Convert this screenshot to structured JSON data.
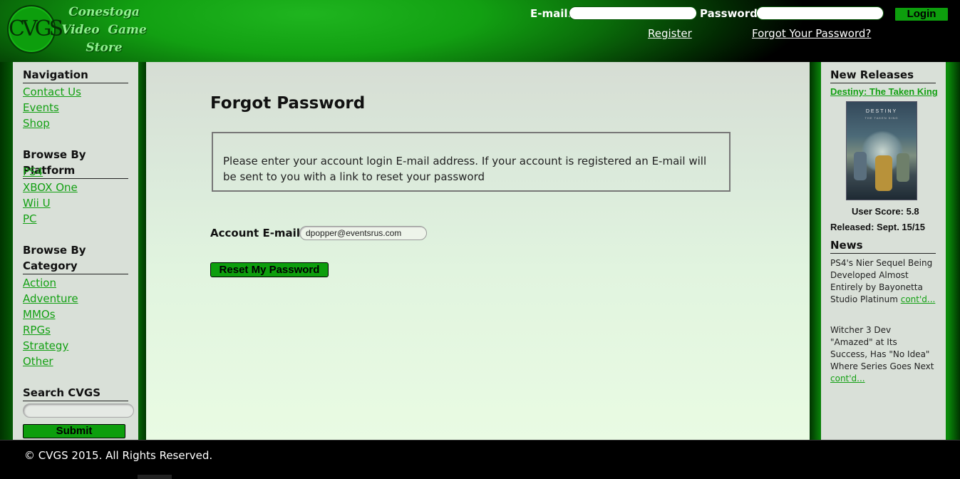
{
  "header": {
    "logo_mark": "CVGS",
    "logo_lines": [
      "Conestoga",
      "Video  Game",
      "Store"
    ],
    "email_label": "E-mail:",
    "password_label": "Password:",
    "login_label": "Login",
    "register_label": "Register",
    "forgot_label": "Forgot Your Password?"
  },
  "left": {
    "navigation_title": "Navigation",
    "navigation": [
      "Contact Us",
      "Events",
      "Shop"
    ],
    "platform_title": "Browse By Platform",
    "platforms": [
      "PS4",
      "XBOX One",
      "Wii U",
      "PC"
    ],
    "category_title_1": "Browse By",
    "category_title_2": "Category",
    "categories": [
      "Action",
      "Adventure",
      "MMOs",
      "RPGs",
      "Strategy",
      "Other"
    ],
    "search_title": "Search CVGS",
    "search_value": "",
    "submit_label": "Submit"
  },
  "main": {
    "title": "Forgot Password",
    "info": "Please enter your account login E-mail address. If your account is registered an E-mail will be sent to you with a link to reset your password",
    "email_label": "Account E-mail:",
    "email_value": "dpopper@eventsrus.com",
    "reset_label": "Reset My Password"
  },
  "right": {
    "releases_title": "New Releases",
    "release_name": "Destiny: The Taken King",
    "box_art_title": "DESTINY",
    "box_art_subtitle": "THE TAKEN KING",
    "user_score": "User Score: 5.8",
    "released": "Released: Sept. 15/15",
    "news_title": "News",
    "news": [
      {
        "text": "PS4's Nier Sequel Being Developed Almost Entirely by Bayonetta Studio Platinum ",
        "more": "cont'd..."
      },
      {
        "text": "Witcher 3 Dev \"Amazed\" at Its Success, Has \"No Idea\" Where Series Goes Next ",
        "more": "cont'd..."
      }
    ]
  },
  "footer": {
    "text": "© CVGS 2015. All Rights Reserved."
  }
}
